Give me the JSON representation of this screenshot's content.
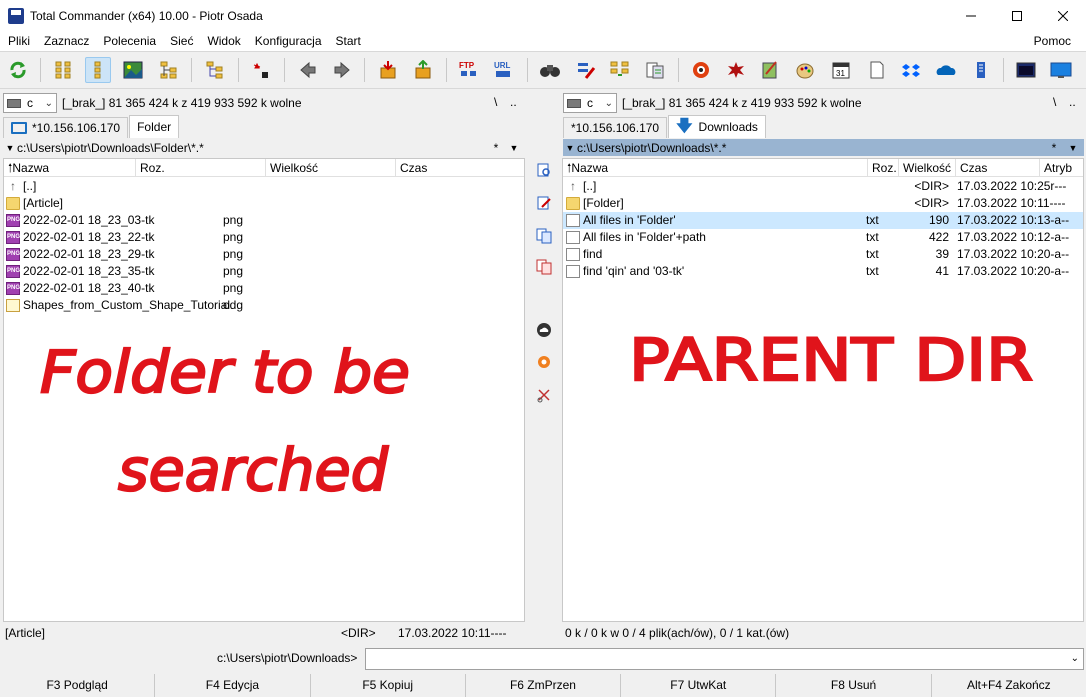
{
  "window": {
    "title": "Total Commander (x64) 10.00 - Piotr Osada"
  },
  "menu": {
    "items": [
      "Pliki",
      "Zaznacz",
      "Polecenia",
      "Sieć",
      "Widok",
      "Konfiguracja",
      "Start"
    ],
    "help": "Pomoc"
  },
  "toolbar": {
    "buttons": [
      "refresh-icon",
      "brief-view-icon",
      "full-view-icon",
      "thumbnails-icon",
      "tree-view-icon",
      "tree-compare-icon",
      "invert-selection-icon",
      "back-icon",
      "forward-icon",
      "pack-icon",
      "unpack-icon",
      "ftp-icon",
      "url-icon",
      "find-icon",
      "multi-rename-icon",
      "sync-dirs-icon",
      "compare-icon",
      "explorer-icon",
      "winrar-icon",
      "notepad-icon",
      "paint-icon",
      "calendar-icon",
      "blank-page-icon",
      "dropbox-icon",
      "onedrive-icon",
      "server-icon",
      "cmd-icon",
      "desktop-icon"
    ],
    "ftp_label": "FTP",
    "url_label": "URL"
  },
  "left": {
    "drive_letter": "c",
    "drive_info": "[_brak_]  81 365 424 k z 419 933 592 k wolne",
    "root": "\\",
    "up": "..",
    "tabs": [
      "*10.156.106.170",
      "Folder"
    ],
    "path": "c:\\Users\\piotr\\Downloads\\Folder\\*.*",
    "star": "*",
    "columns": [
      "Nazwa",
      "Roz.",
      "Wielkość",
      "Czas"
    ],
    "files": [
      {
        "name": "[..]",
        "ext": "",
        "type": "up"
      },
      {
        "name": "[Article]",
        "ext": "",
        "type": "folder"
      },
      {
        "name": "2022-02-01 18_23_03-tk",
        "ext": "png",
        "type": "png"
      },
      {
        "name": "2022-02-01 18_23_22-tk",
        "ext": "png",
        "type": "png"
      },
      {
        "name": "2022-02-01 18_23_29-tk",
        "ext": "png",
        "type": "png"
      },
      {
        "name": "2022-02-01 18_23_35-tk",
        "ext": "png",
        "type": "png"
      },
      {
        "name": "2022-02-01 18_23_40-tk",
        "ext": "png",
        "type": "png"
      },
      {
        "name": "Shapes_from_Custom_Shape_Tutorial",
        "ext": "odg",
        "type": "odg"
      }
    ],
    "status_name": "[Article]",
    "status_dir": "<DIR>",
    "status_date": "17.03.2022 10:11----"
  },
  "right": {
    "drive_letter": "c",
    "drive_info": "[_brak_]  81 365 424 k z 419 933 592 k wolne",
    "root": "\\",
    "up": "..",
    "tabs": [
      "*10.156.106.170",
      "Downloads"
    ],
    "path": "c:\\Users\\piotr\\Downloads\\*.*",
    "star": "*",
    "columns": [
      "Nazwa",
      "Roz.",
      "Wielkość",
      "Czas",
      "Atryb"
    ],
    "files": [
      {
        "name": "[..]",
        "ext": "",
        "size": "<DIR>",
        "date": "17.03.2022 10:25r---",
        "type": "up"
      },
      {
        "name": "[Folder]",
        "ext": "",
        "size": "<DIR>",
        "date": "17.03.2022 10:11----",
        "type": "folder"
      },
      {
        "name": "All files in 'Folder'",
        "ext": "txt",
        "size": "190",
        "date": "17.03.2022 10:13-a--",
        "type": "txt",
        "selected": true
      },
      {
        "name": "All files in 'Folder'+path",
        "ext": "txt",
        "size": "422",
        "date": "17.03.2022 10:12-a--",
        "type": "txt"
      },
      {
        "name": "find",
        "ext": "txt",
        "size": "39",
        "date": "17.03.2022 10:20-a--",
        "type": "txt"
      },
      {
        "name": "find 'qin' and '03-tk'",
        "ext": "txt",
        "size": "41",
        "date": "17.03.2022 10:20-a--",
        "type": "txt"
      }
    ],
    "status": "0 k / 0 k w 0 / 4 plik(ach/ów), 0 / 1 kat.(ów)"
  },
  "cmdline": {
    "path": "c:\\Users\\piotr\\Downloads>",
    "value": ""
  },
  "fkeys": [
    "F3 Podgląd",
    "F4 Edycja",
    "F5 Kopiuj",
    "F6 ZmPrzen",
    "F7 UtwKat",
    "F8 Usuń",
    "Alt+F4 Zakończ"
  ],
  "annotations": {
    "left_line1": "Folder to be",
    "left_line2": "searched",
    "right": "PARENT DIR"
  },
  "colors": {
    "selection": "#cce8ff",
    "active_path": "#99b4d1",
    "annotation": "#e0141b"
  }
}
